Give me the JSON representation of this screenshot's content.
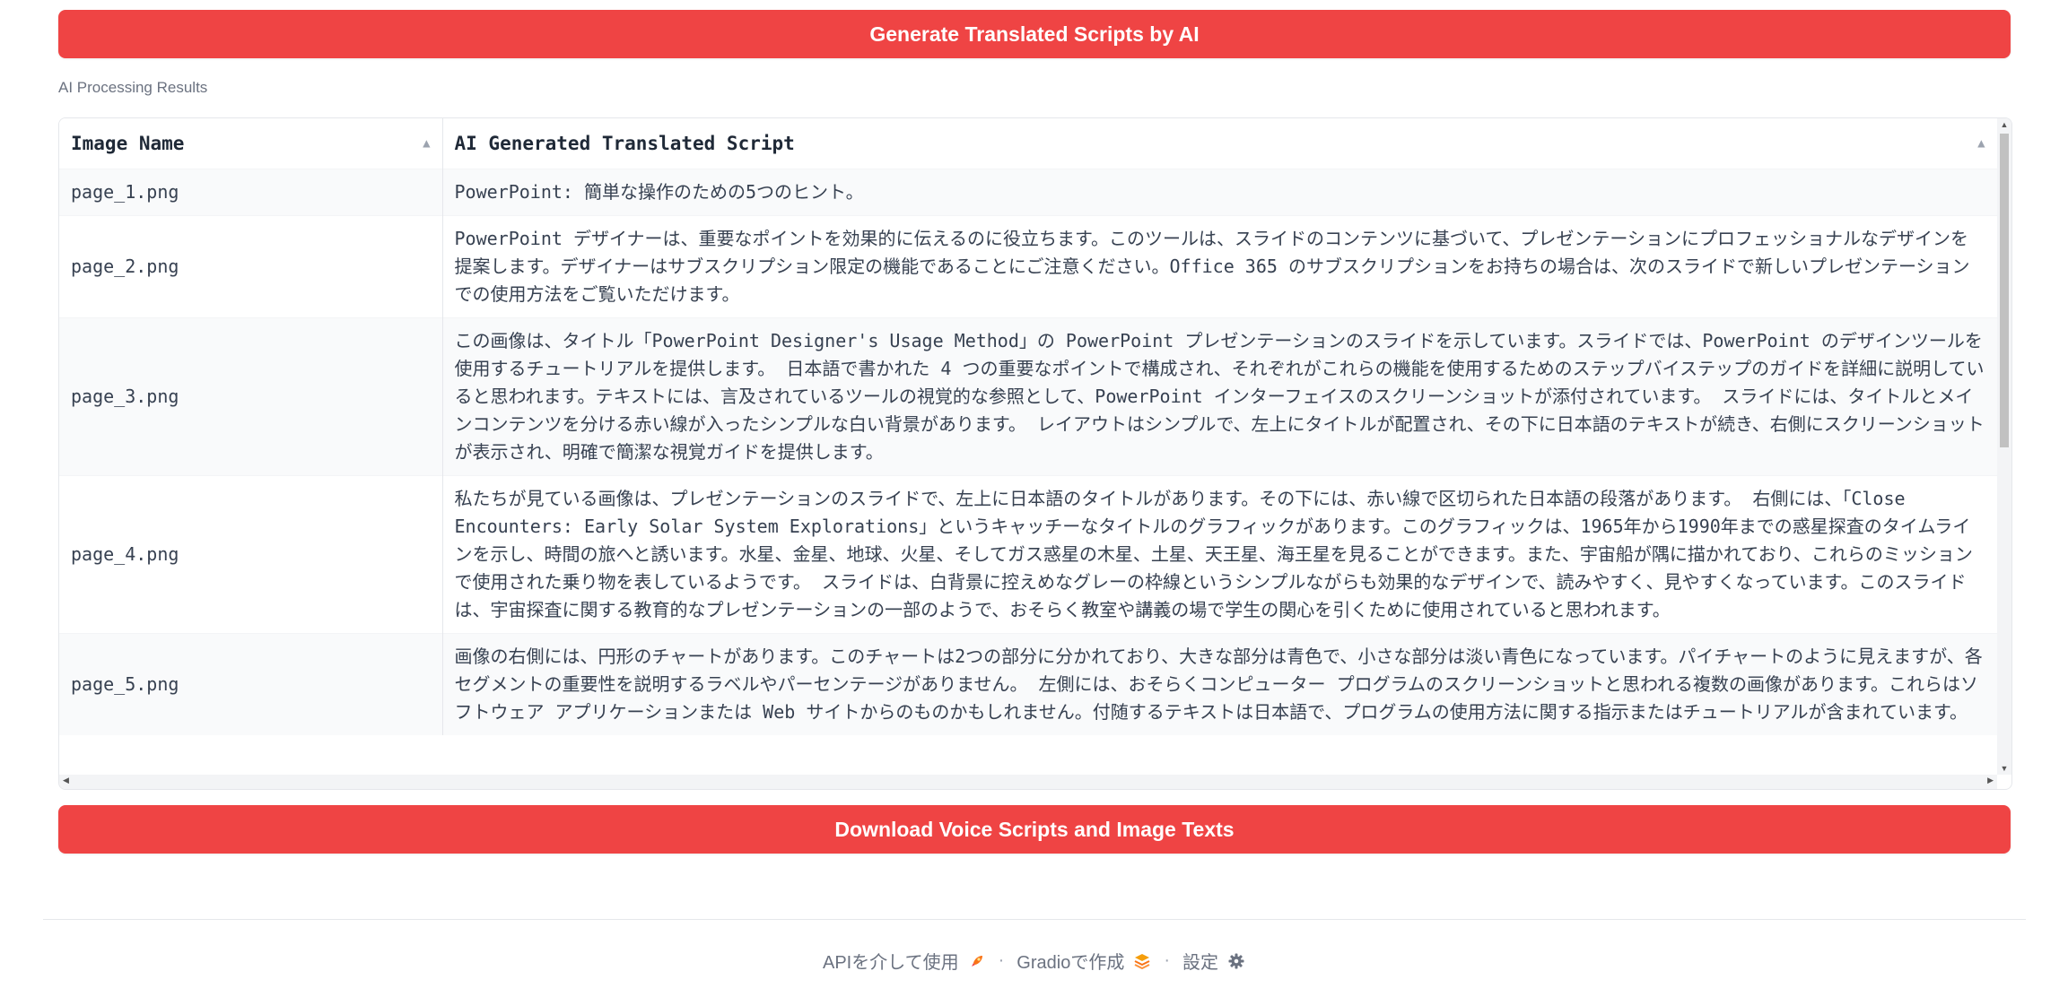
{
  "actions": {
    "generate_label": "Generate Translated Scripts by AI",
    "download_label": "Download Voice Scripts and Image Texts"
  },
  "results": {
    "label": "AI Processing Results",
    "columns": [
      "Image Name",
      "AI Generated Translated Script"
    ],
    "rows": [
      {
        "name": "page_1.png",
        "script": "PowerPoint: 簡単な操作のための5つのヒント。"
      },
      {
        "name": "page_2.png",
        "script": "PowerPoint デザイナーは、重要なポイントを効果的に伝えるのに役立ちます。このツールは、スライドのコンテンツに基づいて、プレゼンテーションにプロフェッショナルなデザインを提案します。デザイナーはサブスクリプション限定の機能であることにご注意ください。Office 365 のサブスクリプションをお持ちの場合は、次のスライドで新しいプレゼンテーションでの使用方法をご覧いただけます。"
      },
      {
        "name": "page_3.png",
        "script": "この画像は、タイトル「PowerPoint Designer's Usage Method」の PowerPoint プレゼンテーションのスライドを示しています。スライドでは、PowerPoint のデザインツールを使用するチュートリアルを提供します。 日本語で書かれた 4 つの重要なポイントで構成され、それぞれがこれらの機能を使用するためのステップバイステップのガイドを詳細に説明していると思われます。テキストには、言及されているツールの視覚的な参照として、PowerPoint インターフェイスのスクリーンショットが添付されています。 スライドには、タイトルとメインコンテンツを分ける赤い線が入ったシンプルな白い背景があります。 レイアウトはシンプルで、左上にタイトルが配置され、その下に日本語のテキストが続き、右側にスクリーンショットが表示され、明確で簡潔な視覚ガイドを提供します。"
      },
      {
        "name": "page_4.png",
        "script": "私たちが見ている画像は、プレゼンテーションのスライドで、左上に日本語のタイトルがあります。その下には、赤い線で区切られた日本語の段落があります。 右側には、「Close Encounters: Early Solar System Explorations」というキャッチーなタイトルのグラフィックがあります。このグラフィックは、1965年から1990年までの惑星探査のタイムラインを示し、時間の旅へと誘います。水星、金星、地球、火星、そしてガス惑星の木星、土星、天王星、海王星を見ることができます。また、宇宙船が隅に描かれており、これらのミッションで使用された乗り物を表しているようです。 スライドは、白背景に控えめなグレーの枠線というシンプルながらも効果的なデザインで、読みやすく、見やすくなっています。このスライドは、宇宙探査に関する教育的なプレゼンテーションの一部のようで、おそらく教室や講義の場で学生の関心を引くために使用されていると思われます。"
      },
      {
        "name": "page_5.png",
        "script": "画像の右側には、円形のチャートがあります。このチャートは2つの部分に分かれており、大きな部分は青色で、小さな部分は淡い青色になっています。パイチャートのように見えますが、各セグメントの重要性を説明するラベルやパーセンテージがありません。 左側には、おそらくコンピューター プログラムのスクリーンショットと思われる複数の画像があります。これらはソフトウェア アプリケーションまたは Web サイトからのものかもしれません。付随するテキストは日本語で、プログラムの使用方法に関する指示またはチュートリアルが含まれています。"
      }
    ]
  },
  "footer": {
    "api_label": "APIを介して使用",
    "gradio_label": "Gradioで作成",
    "settings_label": "設定",
    "separator": "·"
  },
  "icons": {
    "api": "rocket-icon",
    "gradio": "gradio-logo-icon",
    "settings": "gear-icon",
    "sort": "sort-ascending-icon"
  },
  "colors": {
    "primary": "#ef4444",
    "row_alt": "#f9fafb",
    "border": "#e5e7eb"
  }
}
